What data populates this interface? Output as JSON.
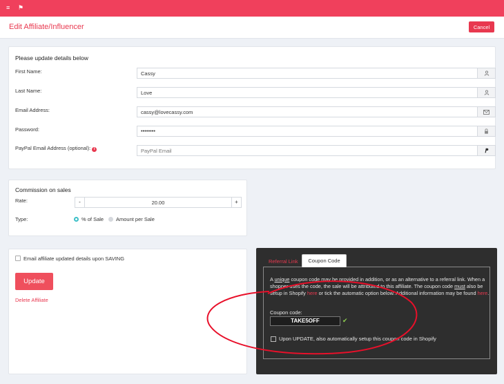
{
  "colors": {
    "topbar": "#f0405c",
    "accent": "#e8384f",
    "teal": "#3bbfc7",
    "dark_panel": "#2e2e2e",
    "annotation": "#e8102a"
  },
  "topbar": {
    "menu_icon": "≡",
    "flag_icon": "⚑"
  },
  "header": {
    "title": "Edit Affiliate/Influencer",
    "cancel_label": "Cancel"
  },
  "details": {
    "title": "Please update details below",
    "first_name": {
      "label": "First Name:",
      "value": "Cassy",
      "icon": "user-icon"
    },
    "last_name": {
      "label": "Last Name:",
      "value": "Love",
      "icon": "user-icon"
    },
    "email": {
      "label": "Email Address:",
      "value": "cassy@lovecassy.com",
      "icon": "envelope-icon"
    },
    "password": {
      "label": "Password:",
      "value": "••••••••",
      "icon": "lock-icon"
    },
    "paypal": {
      "label": "PayPal Email Address (optional):",
      "placeholder": "PayPal Email",
      "icon": "paypal-icon"
    }
  },
  "commission": {
    "title": "Commission on sales",
    "rate_label": "Rate:",
    "rate_value": "20.00",
    "minus": "-",
    "plus": "+",
    "type_label": "Type:",
    "options": [
      "% of Sale",
      "Amount per Sale"
    ],
    "selected": "% of Sale"
  },
  "actions": {
    "email_checkbox_label": "Email affiliate updated details upon SAVING",
    "update_label": "Update",
    "delete_label": "Delete Affiliate"
  },
  "coupon_panel": {
    "tab_referral": "Referral Link",
    "tab_coupon": "Coupon Code",
    "desc_pre": "A ",
    "desc_unique": "unique",
    "desc_mid": " coupon code may be provided in addition, or as an alternative to a referral link. When a shopper uses the code, the sale will be attributed to this affiliate. The coupon code ",
    "desc_must": "must",
    "desc_mid2": " also be setup in Shopify ",
    "desc_here1": "here",
    "desc_mid3": " or tick the automatic option below.  Additional information may be found ",
    "desc_here2": "here",
    "desc_end": ".",
    "coupon_label": "Coupon code:",
    "coupon_value": "TAKE5OFF",
    "valid_mark": "✔",
    "auto_label": "Upon UPDATE, also automatically setup this coupon code in Shopify"
  }
}
